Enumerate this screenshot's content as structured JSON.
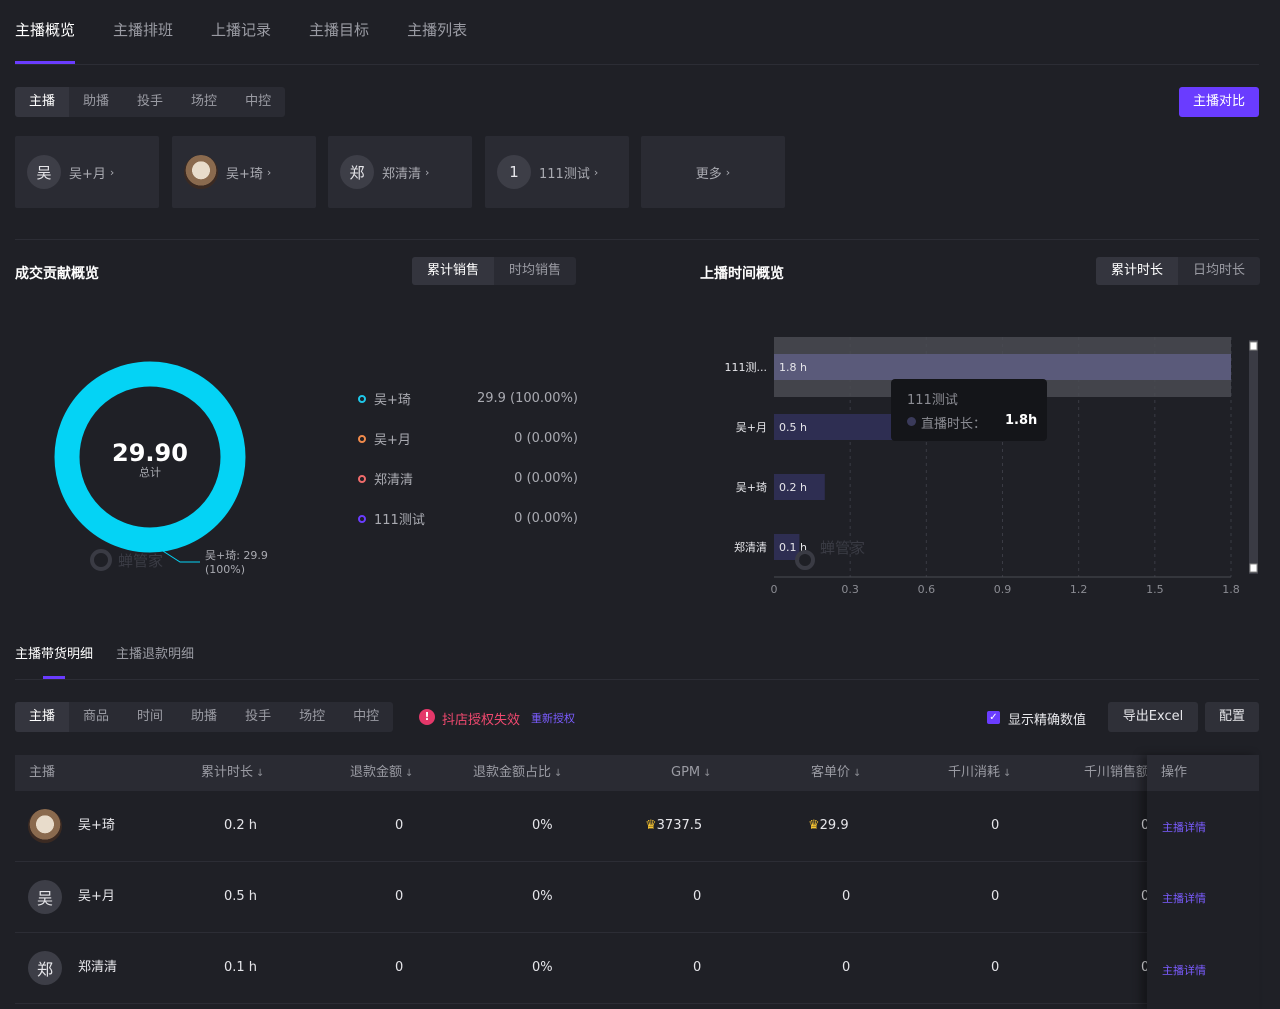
{
  "top_tabs": [
    "主播概览",
    "主播排班",
    "上播记录",
    "主播目标",
    "主播列表"
  ],
  "roles": [
    "主播",
    "助播",
    "投手",
    "场控",
    "中控"
  ],
  "compare_button": "主播对比",
  "anchor_cards": [
    {
      "avatar": "吴",
      "name": "吴+月",
      "chev": "›"
    },
    {
      "avatar": "",
      "name": "吴+琦",
      "chev": "›"
    },
    {
      "avatar": "郑",
      "name": "郑清清",
      "chev": "›"
    },
    {
      "avatar": "1",
      "name": "111测试",
      "chev": "›"
    },
    {
      "avatar": "",
      "name": "更多",
      "chev": "›"
    }
  ],
  "contribution": {
    "title": "成交贡献概览",
    "tabs": [
      "累计销售",
      "时均销售"
    ],
    "total_value": "29.90",
    "total_label": "总计",
    "callout_line1": "吴+琦: 29.9",
    "callout_line2": "(100%)",
    "watermark": "蝉管家",
    "legend": [
      {
        "name": "吴+琦",
        "value": "29.9 (100.00%)",
        "color": "#1ec8ea"
      },
      {
        "name": "吴+月",
        "value": "0 (0.00%)",
        "color": "#f08a4b"
      },
      {
        "name": "郑清清",
        "value": "0 (0.00%)",
        "color": "#ef6b6b"
      },
      {
        "name": "111测试",
        "value": "0 (0.00%)",
        "color": "#6a3cff"
      }
    ]
  },
  "airtime": {
    "title": "上播时间概览",
    "tabs": [
      "累计时长",
      "日均时长"
    ],
    "watermark": "蝉管家",
    "tooltip": {
      "title": "111测试",
      "label": "直播时长：",
      "value": "1.8h"
    }
  },
  "chart_data": {
    "type": "bar",
    "orientation": "horizontal",
    "categories": [
      "111测...",
      "吴+月",
      "吴+琦",
      "郑清清"
    ],
    "values": [
      1.8,
      0.5,
      0.2,
      0.1
    ],
    "value_labels": [
      "1.8 h",
      "0.5 h",
      "0.2 h",
      "0.1 h"
    ],
    "xlim": [
      0,
      1.8
    ],
    "x_ticks": [
      "0",
      "0.3",
      "0.6",
      "0.9",
      "1.2",
      "1.5",
      "1.8"
    ],
    "grid": true
  },
  "detail_tabs": [
    "主播带货明细",
    "主播退款明细"
  ],
  "filter_tabs": [
    "主播",
    "商品",
    "时间",
    "助播",
    "投手",
    "场控",
    "中控"
  ],
  "auth_warning": "抖店授权失效",
  "reauth_link": "重新授权",
  "precise_checkbox": "显示精确数值",
  "export_button": "导出Excel",
  "config_button": "配置",
  "table": {
    "headers": [
      "主播",
      "累计时长",
      "退款金额",
      "退款金额占比",
      "GPM",
      "客单价",
      "千川消耗",
      "千川销售额",
      "操作"
    ],
    "sort_icon": "↓",
    "rows": [
      {
        "avatar": "",
        "name": "吴+琦",
        "duration": "0.2 h",
        "refund": "0",
        "refund_ratio": "0%",
        "gpm": "3737.5",
        "aov": "29.9",
        "qc_cost": "0",
        "qc_sales": "0",
        "action": "主播详情"
      },
      {
        "avatar": "吴",
        "name": "吴+月",
        "duration": "0.5 h",
        "refund": "0",
        "refund_ratio": "0%",
        "gpm": "0",
        "aov": "0",
        "qc_cost": "0",
        "qc_sales": "0",
        "action": "主播详情"
      },
      {
        "avatar": "郑",
        "name": "郑清清",
        "duration": "0.1 h",
        "refund": "0",
        "refund_ratio": "0%",
        "gpm": "0",
        "aov": "0",
        "qc_cost": "0",
        "qc_sales": "0",
        "action": "主播详情"
      }
    ]
  }
}
